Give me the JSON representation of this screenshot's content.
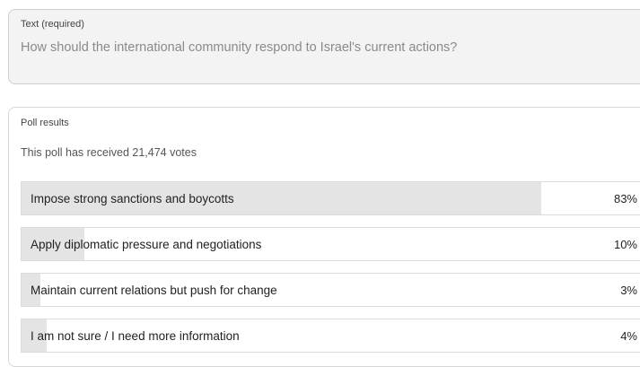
{
  "text_field": {
    "label": "Text (required)",
    "value": "How should the international community respond to Israel's current actions?"
  },
  "poll": {
    "title": "Poll results",
    "vote_summary": "This poll has received 21,474 votes",
    "options": [
      {
        "label": "Impose strong sanctions and boycotts",
        "percent_label": "83%",
        "percent": 83
      },
      {
        "label": "Apply diplomatic pressure and negotiations",
        "percent_label": "10%",
        "percent": 10
      },
      {
        "label": "Maintain current relations but push for change",
        "percent_label": "3%",
        "percent": 3
      },
      {
        "label": "I am not sure / I need more information",
        "percent_label": "4%",
        "percent": 4
      }
    ]
  },
  "colors": {
    "bar_fill": "#e4e4e4",
    "text_field_background": "#f3f3f3"
  }
}
